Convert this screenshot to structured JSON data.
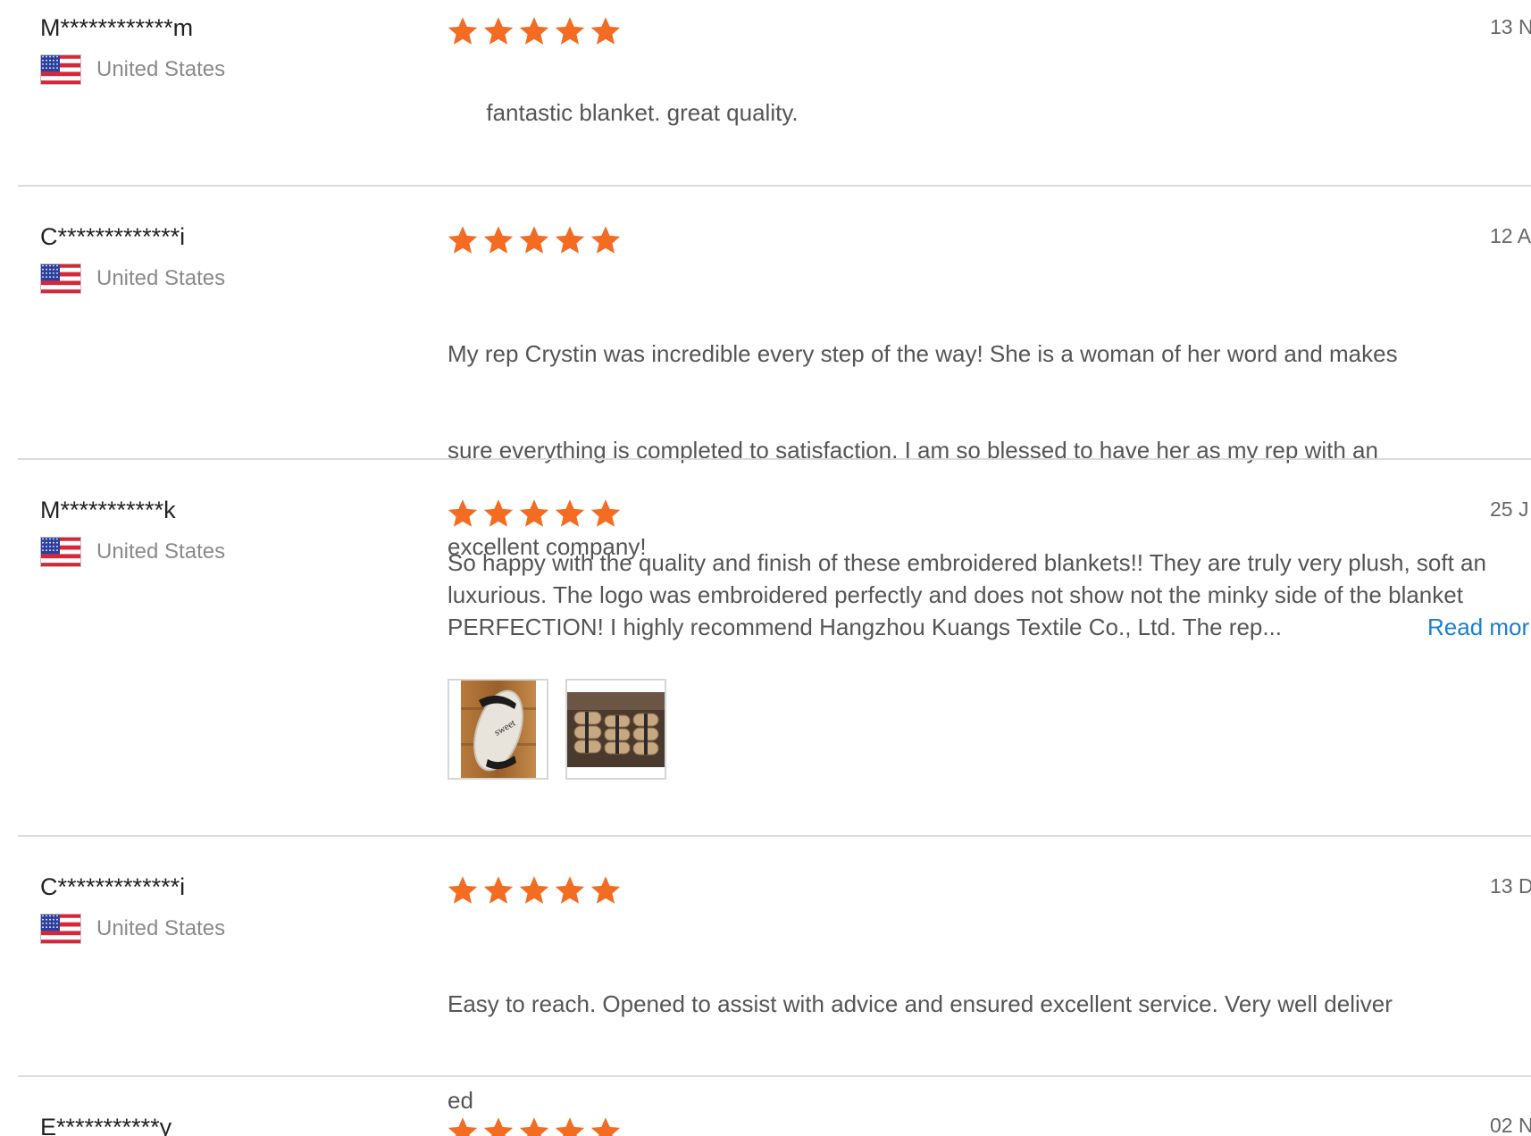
{
  "colors": {
    "star": "#f46b22",
    "link": "#1a7fd0",
    "divider": "#dcdcdc",
    "name": "#222222",
    "text": "#555555",
    "country": "#8a8a8a"
  },
  "reviews": [
    {
      "name": "M************m",
      "country": "United States",
      "flag_icon": "us-flag-icon",
      "rating": 5,
      "date": "13 N",
      "text_lines": [
        "fantastic blanket. great quality."
      ]
    },
    {
      "name": "C*************i",
      "country": "United States",
      "flag_icon": "us-flag-icon",
      "rating": 5,
      "date": "12 A",
      "text_lines": [
        "My rep Crystin was incredible every step of the way! She is a woman of her word and makes",
        "sure everything is completed to satisfaction. I am so blessed to have her as my rep with an",
        "excellent company!"
      ]
    },
    {
      "name": "M***********k",
      "country": "United States",
      "flag_icon": "us-flag-icon",
      "rating": 5,
      "date": "25 J",
      "text_lines": [
        "So happy with the quality and finish of these embroidered blankets!! They are truly very plush, soft an",
        "luxurious.  The logo was embroidered perfectly and does not show not the minky side of the blanket",
        "PERFECTION!  I highly recommend Hangzhou Kuangs Textile Co., Ltd.  The rep..."
      ],
      "read_more": "Read mor",
      "photos": [
        "rolled-blanket-photo",
        "stacked-blankets-photo"
      ]
    },
    {
      "name": "C*************i",
      "country": "United States",
      "flag_icon": "us-flag-icon",
      "rating": 5,
      "date": "13 D",
      "text_lines": [
        "Easy to reach. Opened to assist with advice and ensured excellent service. Very well deliver",
        "ed"
      ]
    },
    {
      "name": "E***********y",
      "country": "",
      "rating": 5,
      "date": "02 N",
      "text_lines": []
    }
  ]
}
